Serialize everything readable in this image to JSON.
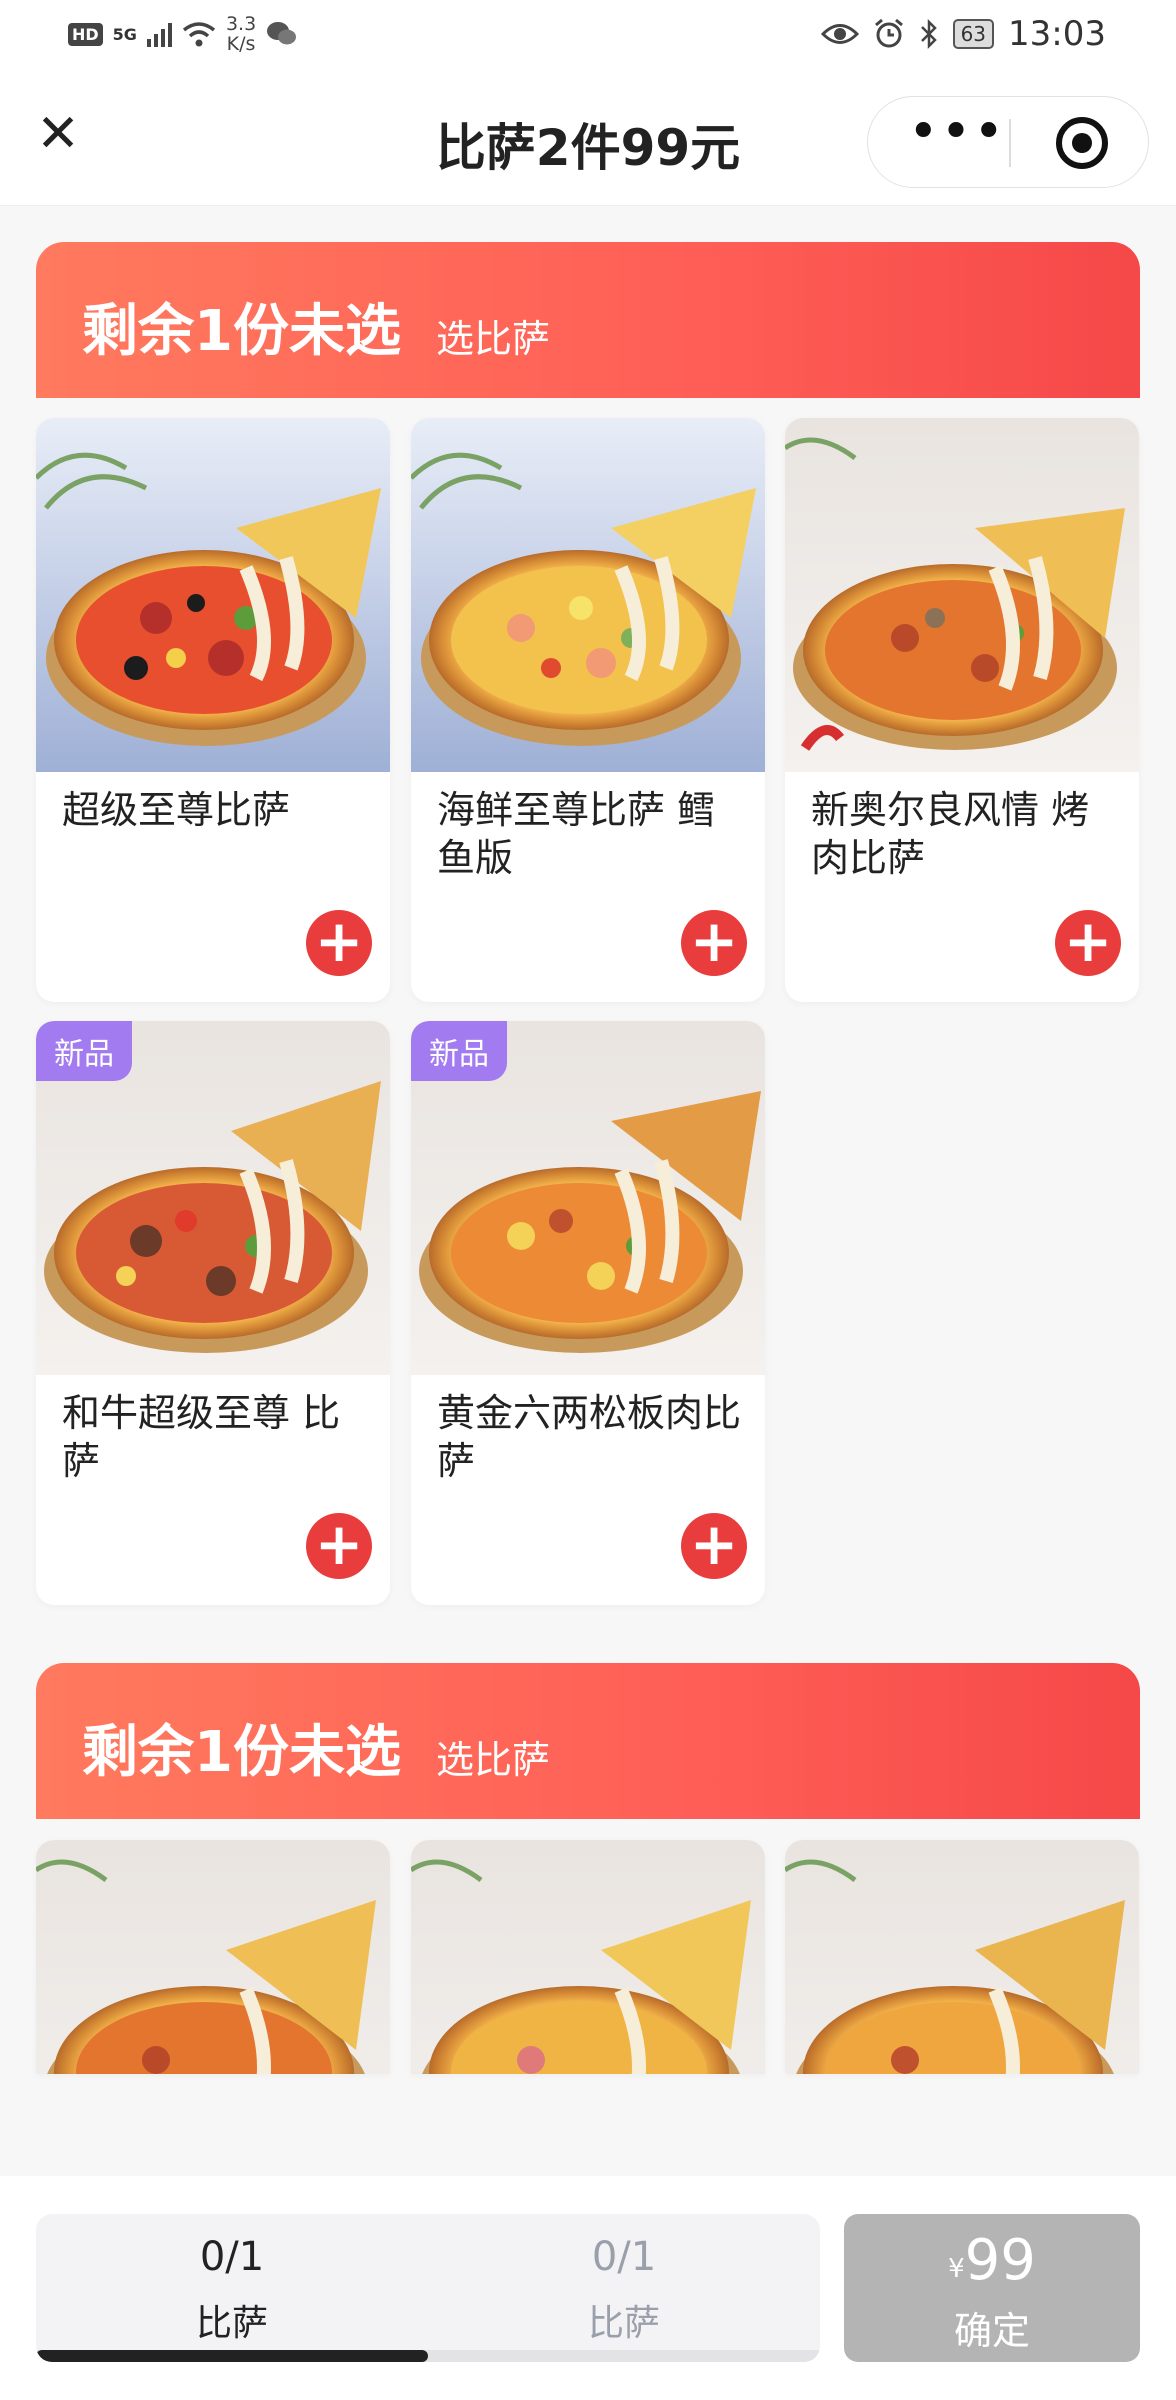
{
  "status_bar": {
    "hd": "HD",
    "network": "5G",
    "speed_value": "3.3",
    "speed_unit": "K/s",
    "battery": "63",
    "time": "13:03",
    "icons": [
      "signal-icon",
      "wifi-icon",
      "wechat-icon",
      "eye-icon",
      "alarm-icon",
      "bluetooth-icon",
      "battery-icon"
    ]
  },
  "nav": {
    "title": "比萨2件99元",
    "close_icon": "close-icon",
    "more_icon": "more-icon",
    "target_icon": "target-icon"
  },
  "sections": [
    {
      "banner_main": "剩余1份未选",
      "banner_sub": "选比萨",
      "items": [
        {
          "name": "超级至尊比萨",
          "badge": ""
        },
        {
          "name": "海鲜至尊比萨 鳕鱼版",
          "badge": ""
        },
        {
          "name": "新奥尔良风情 烤肉比萨",
          "badge": ""
        },
        {
          "name": "和牛超级至尊 比萨",
          "badge": "新品"
        },
        {
          "name": "黄金六两松板肉比萨",
          "badge": "新品"
        }
      ]
    },
    {
      "banner_main": "剩余1份未选",
      "banner_sub": "选比萨"
    }
  ],
  "bottom": {
    "tabs": [
      {
        "count": "0/1",
        "label": "比萨",
        "active": true
      },
      {
        "count": "0/1",
        "label": "比萨",
        "active": false
      }
    ],
    "progress": 0.5,
    "currency": "¥",
    "price": "99",
    "confirm_label": "确定"
  },
  "colors": {
    "accent_red": "#e93d3d",
    "banner_start": "#ff7a5e",
    "banner_end": "#f54848",
    "new_badge": "#a27bf0",
    "confirm_disabled": "#b4b4b4"
  }
}
